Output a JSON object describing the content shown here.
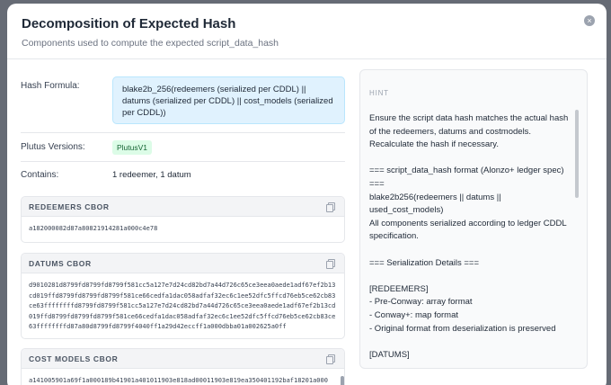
{
  "modal": {
    "title": "Decomposition of Expected Hash",
    "subtitle": "Components used to compute the expected script_data_hash"
  },
  "fields": {
    "hash_formula_label": "Hash Formula:",
    "hash_formula_value": "blake2b_256(redeemers (serialized per CDDL) || datums (serialized per CDDL) || cost_models (serialized per CDDL))",
    "plutus_versions_label": "Plutus Versions:",
    "plutus_version_badge": "PlutusV1",
    "contains_label": "Contains:",
    "contains_value": "1 redeemer, 1 datum"
  },
  "sections": {
    "redeemers": {
      "title": "REDEEMERS CBOR",
      "value": "a182000082d87a80821914281a000c4e78"
    },
    "datums": {
      "title": "DATUMS CBOR",
      "value": "d9010281d8799fd8799fd8799f581cc5a127e7d24cd82bd7a44d726c65ce3eea0aede1adf67ef2b13cd019ffd8799fd8799fd8799f581ce66cedfa1dac058adfaf32ec6c1ee52dfc5ffcd76eb5ce62cb83ce63ffffffffd8799fd8799f581cc5a127e7d24cd82bd7a44d726c65ce3eea0aede1adf67ef2b13cd019ffd8799fd8799fd8799f581ce66cedfa1dac058adfaf32ec6c1ee52dfc5ffcd76eb5ce62cb83ce63ffffffffd87a80d8799fd8799f4040ff1a29d42eccff1a000dbba01a002625a0ff"
    },
    "cost_models": {
      "title": "COST MODELS CBOR",
      "value": "a141005901a69f1a000189b41901a401011903e818ad00011903e819ea350401192baf18201a000"
    }
  },
  "hint": {
    "title": "HINT",
    "lines": [
      "Ensure the script data hash matches the actual hash of the redeemers, datums and costmodels. Recalculate the hash if necessary.",
      "",
      "=== script_data_hash format (Alonzo+ ledger spec) ===",
      "blake2b256(redeemers || datums || used_cost_models)",
      "All components serialized according to ledger CDDL specification.",
      "",
      "=== Serialization Details ===",
      "",
      "[REDEEMERS]",
      "- Pre-Conway: array format",
      "- Conway+: map format",
      "- Original format from deserialization is preserved",
      "",
      "[DATUMS]"
    ]
  }
}
